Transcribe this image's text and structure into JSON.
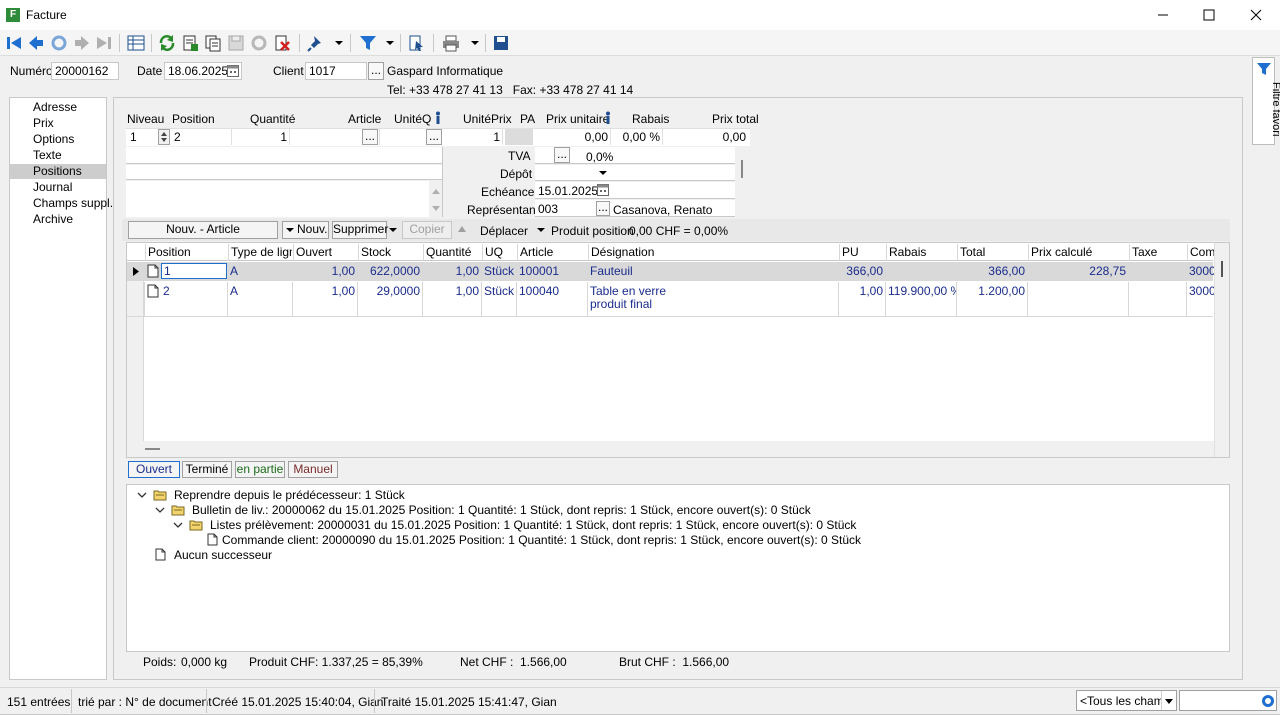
{
  "window": {
    "title": "Facture",
    "app_icon_letter": "F"
  },
  "header": {
    "numero_label": "Numéro",
    "numero_value": "20000162",
    "date_label": "Date",
    "date_value": "18.06.2025",
    "client_label": "Client",
    "client_value": "1017",
    "client_name": "Gaspard Informatique",
    "client_contact": "Tel: +33 478 27 41 13   Fax: +33 478 27 41 14"
  },
  "sidebar": {
    "items": [
      {
        "label": "Adresse"
      },
      {
        "label": "Prix"
      },
      {
        "label": "Options"
      },
      {
        "label": "Texte"
      },
      {
        "label": "Positions"
      },
      {
        "label": "Journal"
      },
      {
        "label": "Champs suppl."
      },
      {
        "label": "Archive"
      }
    ],
    "selected": "Positions"
  },
  "right_panel": {
    "label": "Filtre favori"
  },
  "editor": {
    "labels": {
      "niveau": "Niveau",
      "position": "Position",
      "quantite": "Quantité",
      "article": "Article",
      "uniteq": "UnitéQ",
      "uniteprix": "UnitéPrix",
      "pa": "PA",
      "prix_unitaire": "Prix unitaire",
      "rabais": "Rabais",
      "prix_total": "Prix total",
      "tva": "TVA",
      "depot": "Dépôt",
      "echeance": "Echéance",
      "representant": "Représentant"
    },
    "values": {
      "niveau": "1",
      "position": "2",
      "quantite": "1",
      "uniteprix": "1",
      "prix_unitaire": "0,00",
      "rabais": "0,00 %",
      "prix_total": "0,00",
      "tva": "0,0%",
      "echeance": "15.01.2025",
      "representant_code": "003",
      "representant_name": "Casanova, Renato"
    },
    "ellipsis": "..."
  },
  "actions": {
    "new_article": "Nouv. - Article",
    "new": "Nouv.",
    "delete": "Supprimer",
    "copy": "Copier",
    "move": "Déplacer",
    "product_position": "Produit position",
    "product_position_value": "0,00 CHF = 0,00%"
  },
  "table": {
    "columns": [
      "Position",
      "Type de ligne",
      "Ouvert",
      "Stock",
      "Quantité",
      "UQ",
      "Article",
      "Désignation",
      "PU",
      "Rabais",
      "Total",
      "Prix calculé",
      "Taxe",
      "Comp"
    ],
    "rows": [
      {
        "position": "1",
        "type": "A",
        "ouvert": "1,00",
        "stock": "622,0000",
        "quantite": "1,00",
        "uq": "Stück",
        "article": "100001",
        "designation": "Fauteuil",
        "designation2": "",
        "pu": "366,00",
        "rabais": "",
        "total": "366,00",
        "prix_calcule": "228,75",
        "taxe": "",
        "comp": "3000"
      },
      {
        "position": "2",
        "type": "A",
        "ouvert": "1,00",
        "stock": "29,0000",
        "quantite": "1,00",
        "uq": "Stück",
        "article": "100040",
        "designation": "Table en verre",
        "designation2": "produit final",
        "pu": "1,00",
        "rabais": "119.900,00 %",
        "total": "1.200,00",
        "prix_calcule": "",
        "taxe": "",
        "comp": "3000"
      }
    ]
  },
  "status_tabs": [
    {
      "label": "Ouvert",
      "color": "#1a2c8c"
    },
    {
      "label": "Terminé",
      "color": "#000000"
    },
    {
      "label": "en partie",
      "color": "#1a6b1a"
    },
    {
      "label": "Manuel",
      "color": "#7a2a2a"
    }
  ],
  "tree": [
    {
      "level": 0,
      "text": "Reprendre depuis le prédécesseur: 1 Stück",
      "icon": "folder"
    },
    {
      "level": 1,
      "text": "Bulletin de liv.: 20000062 du 15.01.2025 Position: 1 Quantité: 1 Stück, dont repris: 1 Stück, encore ouvert(s): 0 Stück",
      "icon": "folder"
    },
    {
      "level": 2,
      "text": "Listes prélèvement: 20000031 du 15.01.2025 Position: 1 Quantité: 1 Stück, dont repris: 1 Stück, encore ouvert(s): 0 Stück",
      "icon": "folder"
    },
    {
      "level": 3,
      "text": "Commande client: 20000090 du 15.01.2025 Position: 1 Quantité: 1 Stück, dont repris: 1 Stück, encore ouvert(s): 0 Stück",
      "icon": "document"
    },
    {
      "level": 0,
      "text": "Aucun successeur",
      "icon": "document"
    }
  ],
  "totals": {
    "poids_label": "Poids:",
    "poids_value": "0,000 kg",
    "produit": "Produit CHF: 1.337,25 = 85,39%",
    "net": "Net CHF :  1.566,00",
    "brut": "Brut CHF :  1.566,00"
  },
  "statusbar": {
    "entries": "151 entrées",
    "sorted": "trié par : N° de document",
    "created": "Créé 15.01.2025 15:40:04, Gian",
    "processed": "Traité 15.01.2025 15:41:47, Gian",
    "field_filter": "<Tous les champs>"
  },
  "colors": {
    "accent": "#1f6fd0",
    "selected_row": "#d9d9d9",
    "green_icon": "#2a8a2a",
    "blue_text": "#1a2c8c"
  }
}
